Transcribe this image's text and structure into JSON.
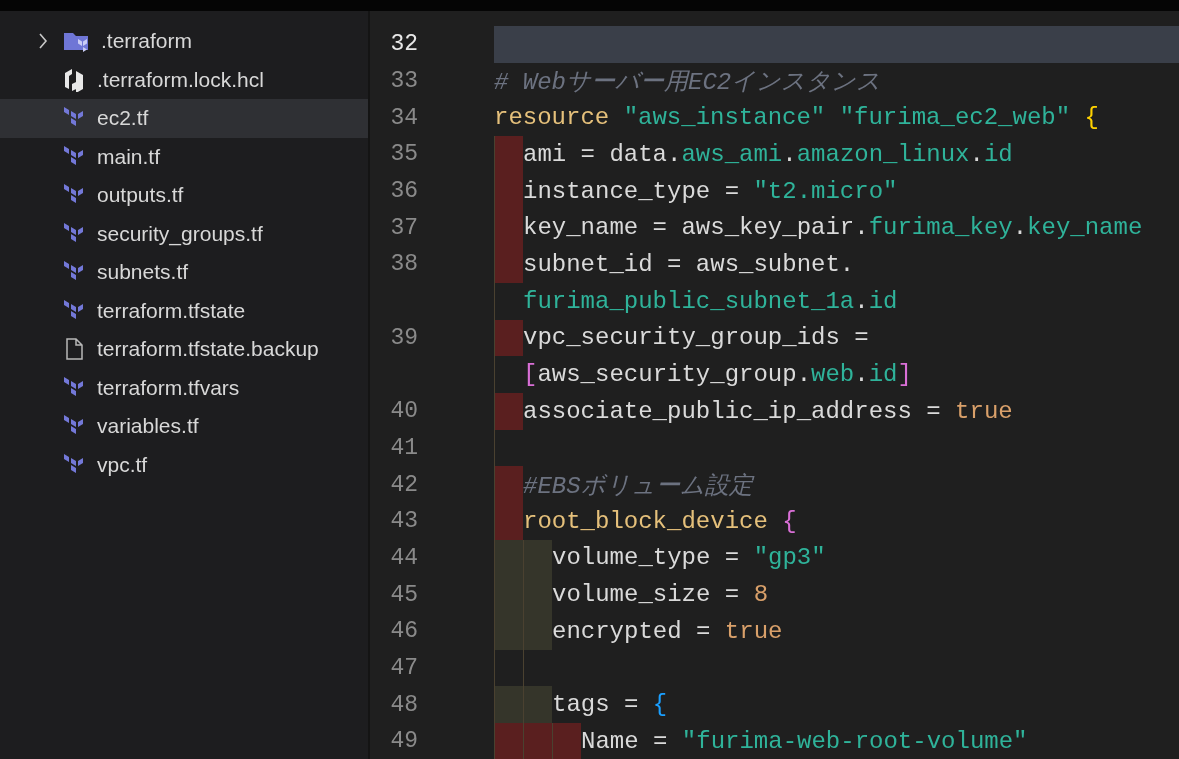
{
  "explorer": {
    "items": [
      {
        "label": ".terraform",
        "kind": "folder",
        "expanded": false,
        "selected": false
      },
      {
        "label": ".terraform.lock.hcl",
        "kind": "lockfile",
        "selected": false
      },
      {
        "label": "ec2.tf",
        "kind": "terraform",
        "selected": true
      },
      {
        "label": "main.tf",
        "kind": "terraform",
        "selected": false
      },
      {
        "label": "outputs.tf",
        "kind": "terraform",
        "selected": false
      },
      {
        "label": "security_groups.tf",
        "kind": "terraform",
        "selected": false
      },
      {
        "label": "subnets.tf",
        "kind": "terraform",
        "selected": false
      },
      {
        "label": "terraform.tfstate",
        "kind": "terraform",
        "selected": false
      },
      {
        "label": "terraform.tfstate.backup",
        "kind": "file",
        "selected": false
      },
      {
        "label": "terraform.tfvars",
        "kind": "terraform",
        "selected": false
      },
      {
        "label": "variables.tf",
        "kind": "terraform",
        "selected": false
      },
      {
        "label": "vpc.tf",
        "kind": "terraform",
        "selected": false
      }
    ]
  },
  "editor": {
    "lines": [
      {
        "number": "32",
        "selected": true
      },
      {
        "number": "33",
        "selected": false,
        "tokens": [
          {
            "text": "# Webサーバー用EC2インスタンス",
            "kind": "comment"
          }
        ]
      },
      {
        "number": "34",
        "selected": false,
        "tokens": [
          {
            "text": "resource ",
            "kind": "keyword"
          },
          {
            "text": "\"aws_instance\" \"furima_ec2_web\" ",
            "kind": "string"
          },
          {
            "text": "{",
            "kind": "brace1"
          }
        ]
      },
      {
        "number": "35",
        "selected": false,
        "indent": [
          {
            "kind": "error"
          }
        ],
        "tokens": [
          {
            "text": "ami = data.",
            "kind": "plain"
          },
          {
            "text": "aws_ami",
            "kind": "attr"
          },
          {
            "text": ".",
            "kind": "plain"
          },
          {
            "text": "amazon_linux",
            "kind": "attr"
          },
          {
            "text": ".",
            "kind": "plain"
          },
          {
            "text": "id",
            "kind": "attr"
          }
        ]
      },
      {
        "number": "36",
        "selected": false,
        "indent": [
          {
            "kind": "error"
          }
        ],
        "tokens": [
          {
            "text": "instance_type = ",
            "kind": "plain"
          },
          {
            "text": "\"t2.micro\"",
            "kind": "string"
          }
        ]
      },
      {
        "number": "37",
        "selected": false,
        "indent": [
          {
            "kind": "error"
          }
        ],
        "tokens": [
          {
            "text": "key_name = aws_key_pair.",
            "kind": "plain"
          },
          {
            "text": "furima_key",
            "kind": "attr"
          },
          {
            "text": ".",
            "kind": "plain"
          },
          {
            "text": "key_name",
            "kind": "attr"
          }
        ]
      },
      {
        "number": "38",
        "selected": false,
        "indent": [
          {
            "kind": "error"
          }
        ],
        "tokens": [
          {
            "text": "subnet_id = aws_subnet.",
            "kind": "plain"
          }
        ]
      },
      {
        "selected": false,
        "indent": [
          {
            "kind": "guide"
          }
        ],
        "tokens": [
          {
            "text": "furima_public_subnet_1a",
            "kind": "attr"
          },
          {
            "text": ".",
            "kind": "plain"
          },
          {
            "text": "id",
            "kind": "attr"
          }
        ]
      },
      {
        "number": "39",
        "selected": false,
        "indent": [
          {
            "kind": "error"
          }
        ],
        "tokens": [
          {
            "text": "vpc_security_group_ids =",
            "kind": "plain"
          }
        ]
      },
      {
        "selected": false,
        "indent": [
          {
            "kind": "guide"
          }
        ],
        "tokens": [
          {
            "text": "[",
            "kind": "brace2"
          },
          {
            "text": "aws_security_group.",
            "kind": "plain"
          },
          {
            "text": "web",
            "kind": "attr"
          },
          {
            "text": ".",
            "kind": "plain"
          },
          {
            "text": "id",
            "kind": "attr"
          },
          {
            "text": "]",
            "kind": "brace2"
          }
        ]
      },
      {
        "number": "40",
        "selected": false,
        "indent": [
          {
            "kind": "error"
          }
        ],
        "tokens": [
          {
            "text": "associate_public_ip_address = ",
            "kind": "plain"
          },
          {
            "text": "true",
            "kind": "number"
          }
        ]
      },
      {
        "number": "41",
        "selected": false,
        "indent": [
          {
            "kind": "guide"
          }
        ]
      },
      {
        "number": "42",
        "selected": false,
        "indent": [
          {
            "kind": "error"
          }
        ],
        "tokens": [
          {
            "text": "#EBSボリューム設定",
            "kind": "comment"
          }
        ]
      },
      {
        "number": "43",
        "selected": false,
        "indent": [
          {
            "kind": "error"
          }
        ],
        "tokens": [
          {
            "text": "root_block_device ",
            "kind": "keyword"
          },
          {
            "text": "{",
            "kind": "brace2"
          }
        ]
      },
      {
        "number": "44",
        "selected": false,
        "indent": [
          {
            "kind": "warn"
          },
          {
            "kind": "warn"
          }
        ],
        "tokens": [
          {
            "text": "volume_type = ",
            "kind": "plain"
          },
          {
            "text": "\"gp3\"",
            "kind": "string"
          }
        ]
      },
      {
        "number": "45",
        "selected": false,
        "indent": [
          {
            "kind": "warn"
          },
          {
            "kind": "warn"
          }
        ],
        "tokens": [
          {
            "text": "volume_size = ",
            "kind": "plain"
          },
          {
            "text": "8",
            "kind": "number"
          }
        ]
      },
      {
        "number": "46",
        "selected": false,
        "indent": [
          {
            "kind": "warn"
          },
          {
            "kind": "warn"
          }
        ],
        "tokens": [
          {
            "text": "encrypted = ",
            "kind": "plain"
          },
          {
            "text": "true",
            "kind": "number"
          }
        ]
      },
      {
        "number": "47",
        "selected": false,
        "indent": [
          {
            "kind": "guide"
          },
          {
            "kind": "guide"
          }
        ]
      },
      {
        "number": "48",
        "selected": false,
        "indent": [
          {
            "kind": "warn"
          },
          {
            "kind": "warn"
          }
        ],
        "tokens": [
          {
            "text": "tags = ",
            "kind": "plain"
          },
          {
            "text": "{",
            "kind": "brace3"
          }
        ]
      },
      {
        "number": "49",
        "selected": false,
        "indent": [
          {
            "kind": "error"
          },
          {
            "kind": "error"
          },
          {
            "kind": "error"
          }
        ],
        "tokens": [
          {
            "text": "Name = ",
            "kind": "plain"
          },
          {
            "text": "\"furima-web-root-volume\"",
            "kind": "string"
          }
        ]
      }
    ]
  }
}
